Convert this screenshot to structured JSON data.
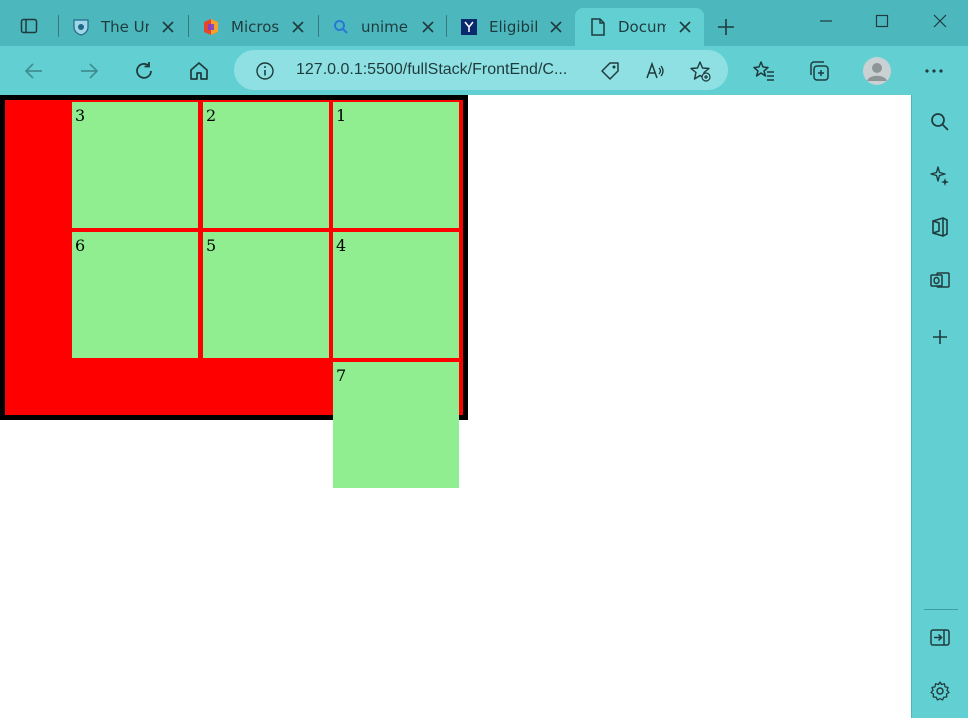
{
  "browser": {
    "tabs": [
      {
        "title": "The Un",
        "icon": "university-shield-icon"
      },
      {
        "title": "Micros",
        "icon": "office-icon"
      },
      {
        "title": "unimel",
        "icon": "search-icon"
      },
      {
        "title": "Eligibil",
        "icon": "university-crest-icon"
      },
      {
        "title": "Docum",
        "icon": "document-icon",
        "active": true
      }
    ],
    "address_bar": {
      "url": "127.0.0.1:5500/fullStack/FrontEnd/C..."
    }
  },
  "page": {
    "boxes": [
      "3",
      "2",
      "1",
      "6",
      "5",
      "4",
      "7"
    ],
    "colors": {
      "container_background": "#ff0000",
      "container_border": "#000000",
      "box_background": "#90ee90"
    }
  }
}
